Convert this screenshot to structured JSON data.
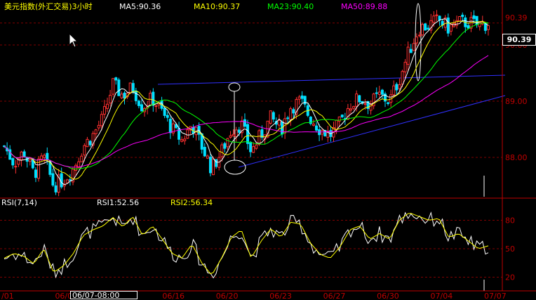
{
  "main_header": {
    "title": "美元指数(外汇交易)3小时",
    "ma5": "MA5:90.36",
    "ma10": "MA10:90.37",
    "ma23": "MA23:90.40",
    "ma50": "MA50:89.88"
  },
  "rsi_header": {
    "title": "RSI(7,14)",
    "rsi1": "RSI1:52.56",
    "rsi2": "RSI2:56.34"
  },
  "price_axis": {
    "top_label": "90.39",
    "ticks": [
      "90.00",
      "89.00",
      "88.00"
    ],
    "current": "90.39"
  },
  "rsi_axis": {
    "ticks": [
      "80",
      "50",
      "20"
    ]
  },
  "date_axis": [
    "/01",
    "06/06",
    "/13",
    "06/16",
    "06/20",
    "06/23",
    "06/27",
    "06/30",
    "07/04",
    "07/07"
  ],
  "time_tip": "06/07-08:00",
  "colors": {
    "bg": "#000000",
    "up": "#ff3030",
    "down": "#00e0ff",
    "ma5": "#ffffff",
    "ma10": "#ffff00",
    "ma23": "#00ff00",
    "ma50": "#ff00ff",
    "trend": "#3030ff",
    "grid": "#800000",
    "axis": "#c00000",
    "text": "#ffffff",
    "rsi1": "#ffffff",
    "rsi2": "#ffff00"
  },
  "icons": {
    "cursor": "arrow-cursor-icon"
  },
  "chart_data": {
    "type": "candlestick",
    "title": "美元指数(外汇交易)3小时",
    "price_ylim": [
      87.3,
      90.55
    ],
    "rsi_ylim": [
      10,
      90
    ],
    "anchors": [
      [
        88.2,
        40
      ],
      [
        87.9,
        45
      ],
      [
        88.1,
        42
      ],
      [
        87.7,
        34
      ],
      [
        88.0,
        50
      ],
      [
        87.5,
        25
      ],
      [
        87.6,
        32
      ],
      [
        87.8,
        45
      ],
      [
        88.2,
        64
      ],
      [
        88.4,
        70
      ],
      [
        88.7,
        74
      ],
      [
        89.3,
        83
      ],
      [
        89.1,
        73
      ],
      [
        89.25,
        84
      ],
      [
        88.9,
        64
      ],
      [
        89.05,
        74
      ],
      [
        88.8,
        60
      ],
      [
        88.5,
        45
      ],
      [
        88.3,
        40
      ],
      [
        88.6,
        55
      ],
      [
        88.2,
        35
      ],
      [
        87.8,
        22
      ],
      [
        88.1,
        40
      ],
      [
        88.5,
        62
      ],
      [
        88.6,
        70
      ],
      [
        88.1,
        40
      ],
      [
        88.4,
        58
      ],
      [
        88.7,
        71
      ],
      [
        88.5,
        62
      ],
      [
        88.9,
        78
      ],
      [
        89.0,
        76
      ],
      [
        88.7,
        56
      ],
      [
        88.5,
        44
      ],
      [
        88.4,
        40
      ],
      [
        88.6,
        52
      ],
      [
        88.95,
        70
      ],
      [
        89.05,
        74
      ],
      [
        88.95,
        60
      ],
      [
        89.1,
        66
      ],
      [
        89.0,
        60
      ],
      [
        89.4,
        80
      ],
      [
        89.9,
        88
      ],
      [
        90.3,
        84
      ],
      [
        90.35,
        80
      ],
      [
        90.45,
        82
      ],
      [
        90.3,
        62
      ],
      [
        90.4,
        66
      ],
      [
        90.4,
        58
      ],
      [
        90.35,
        50
      ],
      [
        90.39,
        53
      ]
    ],
    "rsi1_last": 52.56,
    "rsi2_last": 56.34
  }
}
